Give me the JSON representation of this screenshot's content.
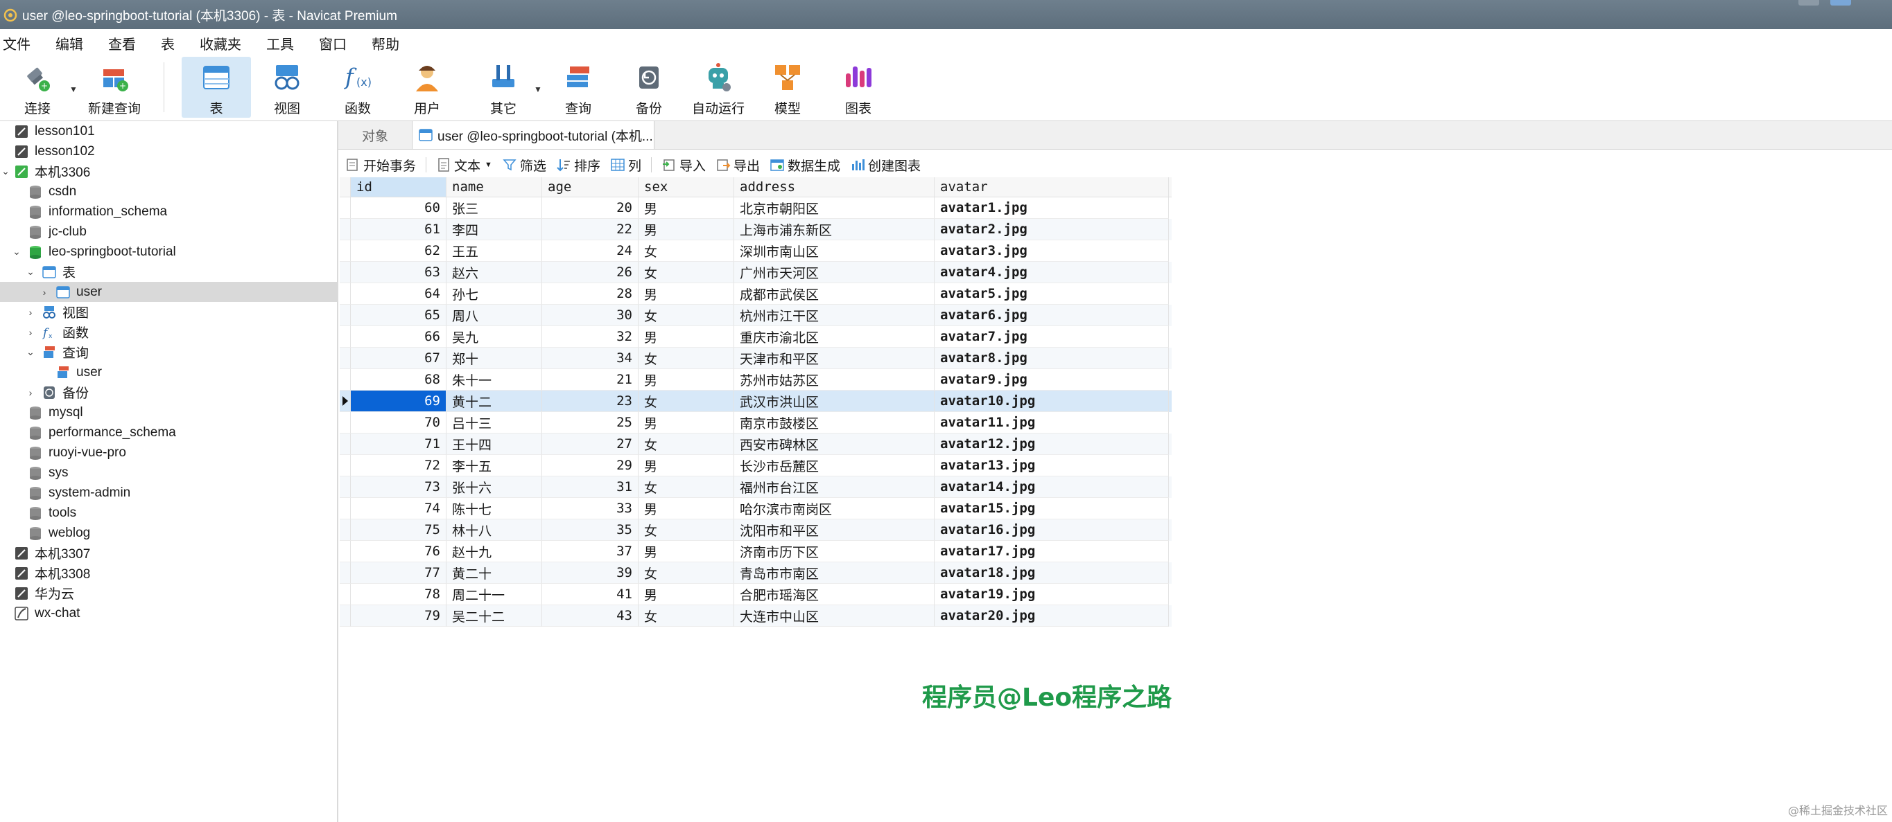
{
  "window": {
    "title": "user @leo-springboot-tutorial (本机3306) - 表 - Navicat Premium"
  },
  "menu": [
    "文件",
    "编辑",
    "查看",
    "表",
    "收藏夹",
    "工具",
    "窗口",
    "帮助"
  ],
  "toolbar": {
    "connect": "连接",
    "new_query": "新建查询",
    "table": "表",
    "view": "视图",
    "function": "函数",
    "user": "用户",
    "other": "其它",
    "query": "查询",
    "backup": "备份",
    "automation": "自动运行",
    "model": "模型",
    "chart": "图表"
  },
  "tree": [
    {
      "label": "lesson101"
    },
    {
      "label": "lesson102"
    },
    {
      "label": "本机3306"
    },
    {
      "label": "csdn"
    },
    {
      "label": "information_schema"
    },
    {
      "label": "jc-club"
    },
    {
      "label": "leo-springboot-tutorial"
    },
    {
      "label": "表"
    },
    {
      "label": "user"
    },
    {
      "label": "视图"
    },
    {
      "label": "函数"
    },
    {
      "label": "查询"
    },
    {
      "label": "user"
    },
    {
      "label": "备份"
    },
    {
      "label": "mysql"
    },
    {
      "label": "performance_schema"
    },
    {
      "label": "ruoyi-vue-pro"
    },
    {
      "label": "sys"
    },
    {
      "label": "system-admin"
    },
    {
      "label": "tools"
    },
    {
      "label": "weblog"
    },
    {
      "label": "本机3307"
    },
    {
      "label": "本机3308"
    },
    {
      "label": "华为云"
    },
    {
      "label": "wx-chat"
    }
  ],
  "tabs": {
    "objects": "对象",
    "active": "user @leo-springboot-tutorial (本机..."
  },
  "table_toolbar": {
    "begin_tx": "开始事务",
    "text": "文本",
    "filter": "筛选",
    "sort": "排序",
    "columns": "列",
    "import": "导入",
    "export": "导出",
    "data_gen": "数据生成",
    "create_chart": "创建图表"
  },
  "columns": [
    "id",
    "name",
    "age",
    "sex",
    "address",
    "avatar"
  ],
  "rows": [
    [
      "60",
      "张三",
      "20",
      "男",
      "北京市朝阳区",
      "avatar1.jpg"
    ],
    [
      "61",
      "李四",
      "22",
      "男",
      "上海市浦东新区",
      "avatar2.jpg"
    ],
    [
      "62",
      "王五",
      "24",
      "女",
      "深圳市南山区",
      "avatar3.jpg"
    ],
    [
      "63",
      "赵六",
      "26",
      "女",
      "广州市天河区",
      "avatar4.jpg"
    ],
    [
      "64",
      "孙七",
      "28",
      "男",
      "成都市武侯区",
      "avatar5.jpg"
    ],
    [
      "65",
      "周八",
      "30",
      "女",
      "杭州市江干区",
      "avatar6.jpg"
    ],
    [
      "66",
      "吴九",
      "32",
      "男",
      "重庆市渝北区",
      "avatar7.jpg"
    ],
    [
      "67",
      "郑十",
      "34",
      "女",
      "天津市和平区",
      "avatar8.jpg"
    ],
    [
      "68",
      "朱十一",
      "21",
      "男",
      "苏州市姑苏区",
      "avatar9.jpg"
    ],
    [
      "69",
      "黄十二",
      "23",
      "女",
      "武汉市洪山区",
      "avatar10.jpg"
    ],
    [
      "70",
      "吕十三",
      "25",
      "男",
      "南京市鼓楼区",
      "avatar11.jpg"
    ],
    [
      "71",
      "王十四",
      "27",
      "女",
      "西安市碑林区",
      "avatar12.jpg"
    ],
    [
      "72",
      "李十五",
      "29",
      "男",
      "长沙市岳麓区",
      "avatar13.jpg"
    ],
    [
      "73",
      "张十六",
      "31",
      "女",
      "福州市台江区",
      "avatar14.jpg"
    ],
    [
      "74",
      "陈十七",
      "33",
      "男",
      "哈尔滨市南岗区",
      "avatar15.jpg"
    ],
    [
      "75",
      "林十八",
      "35",
      "女",
      "沈阳市和平区",
      "avatar16.jpg"
    ],
    [
      "76",
      "赵十九",
      "37",
      "男",
      "济南市历下区",
      "avatar17.jpg"
    ],
    [
      "77",
      "黄二十",
      "39",
      "女",
      "青岛市市南区",
      "avatar18.jpg"
    ],
    [
      "78",
      "周二十一",
      "41",
      "男",
      "合肥市瑶海区",
      "avatar19.jpg"
    ],
    [
      "79",
      "吴二十二",
      "43",
      "女",
      "大连市中山区",
      "avatar20.jpg"
    ]
  ],
  "selected_row_id": "69",
  "watermark": "程序员@Leo程序之路",
  "corner_note": "@稀土掘金技术社区",
  "colors": {
    "accent": "#0a64d6",
    "titlebar": "#5d6e7c",
    "watermark": "#1f9a4a"
  }
}
